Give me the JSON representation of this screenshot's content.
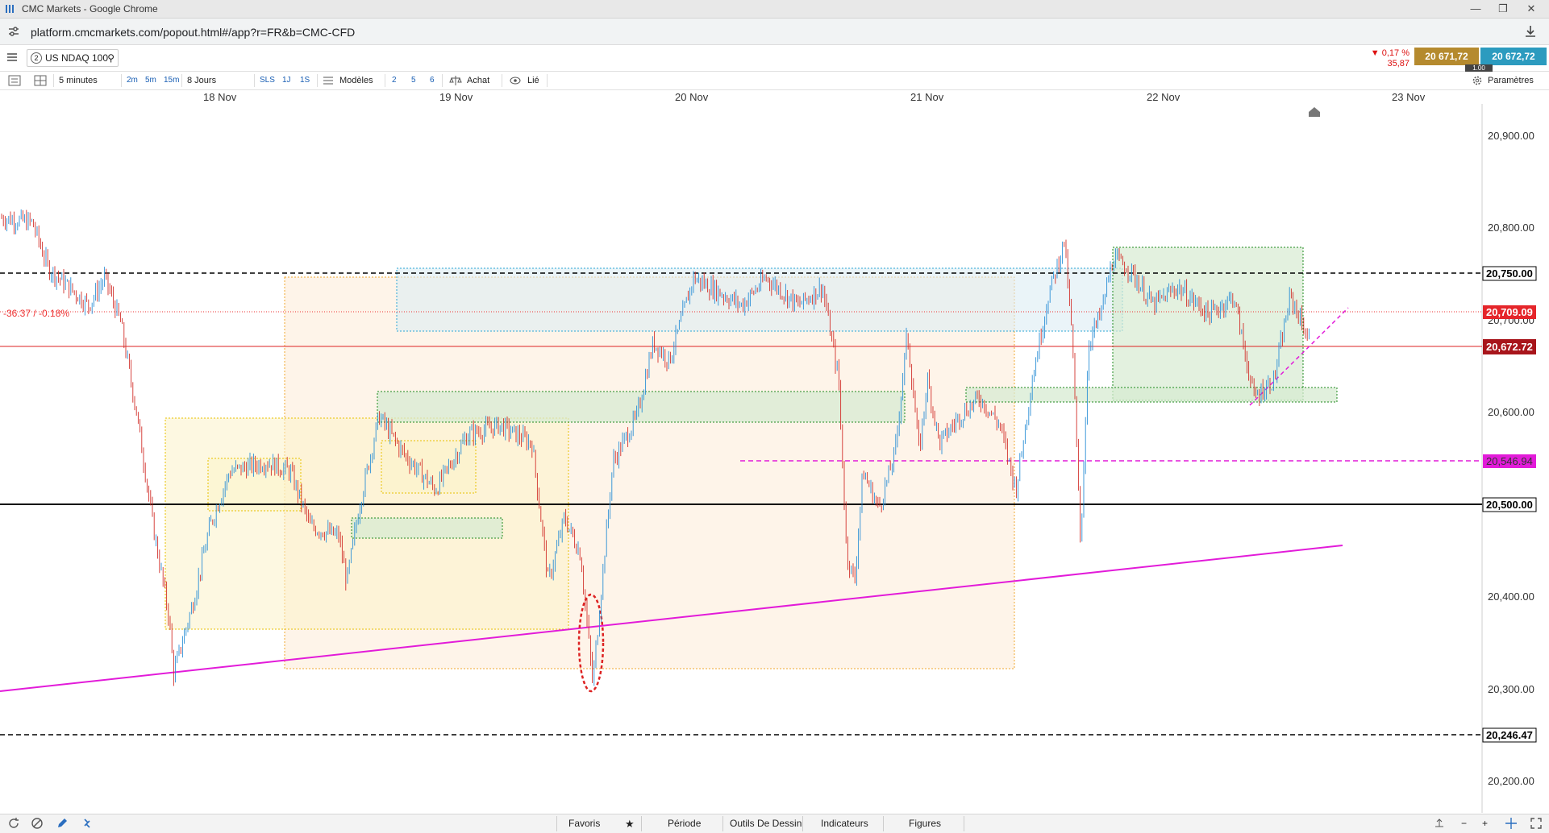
{
  "window": {
    "title": "CMC Markets - Google Chrome"
  },
  "browser": {
    "url": "platform.cmcmarkets.com/popout.html#/app?r=FR&b=CMC-CFD"
  },
  "instrument": {
    "badge": "2",
    "symbol": "US NDAQ 100"
  },
  "quote": {
    "change_pct": "▼ 0,17 %",
    "change_abs": "35,87",
    "bid": "20 671,72",
    "ask": "20 672,72",
    "spread": "1.00"
  },
  "toolbar": {
    "interval": "5 minutes",
    "quick_intervals": [
      "2m",
      "5m",
      "15m"
    ],
    "period": "8 Jours",
    "quick_periods": [
      "SLS",
      "1J",
      "1S"
    ],
    "templates": "Modèles",
    "layouts": [
      "2",
      "5",
      "6"
    ],
    "buy": "Achat",
    "linked": "Lié",
    "settings": "Paramètres"
  },
  "date_axis": [
    "18 Nov",
    "19 Nov",
    "20 Nov",
    "21 Nov",
    "22 Nov",
    "23 Nov"
  ],
  "price_axis": {
    "ticks": [
      "20,900.00",
      "20,800.00",
      "20,700.00",
      "20,600.00",
      "20,400.00",
      "20,300.00",
      "20,200.00"
    ],
    "labels": [
      {
        "text": "20,750.00",
        "style": "black-outline"
      },
      {
        "text": "20,709.09",
        "style": "red"
      },
      {
        "text": "20,672.72",
        "style": "darkred"
      },
      {
        "text": "20,546.94",
        "style": "magenta"
      },
      {
        "text": "20,500.00",
        "style": "black-outline"
      },
      {
        "text": "20,246.47",
        "style": "black-outline"
      }
    ]
  },
  "change_annotation": "-36.37 / -0.18%",
  "bottom_bar": {
    "favorites": "Favoris",
    "period": "Période",
    "drawing_tools": "Outils De Dessin",
    "indicators": "Indicateurs",
    "figures": "Figures"
  },
  "colors": {
    "bid": "#b58a2e",
    "ask": "#2c9bbf",
    "candle_up": "#2b8fd6",
    "candle_down": "#d2302b",
    "trendline": "#e21bd9",
    "dashed_magenta": "#e21bd9"
  }
}
